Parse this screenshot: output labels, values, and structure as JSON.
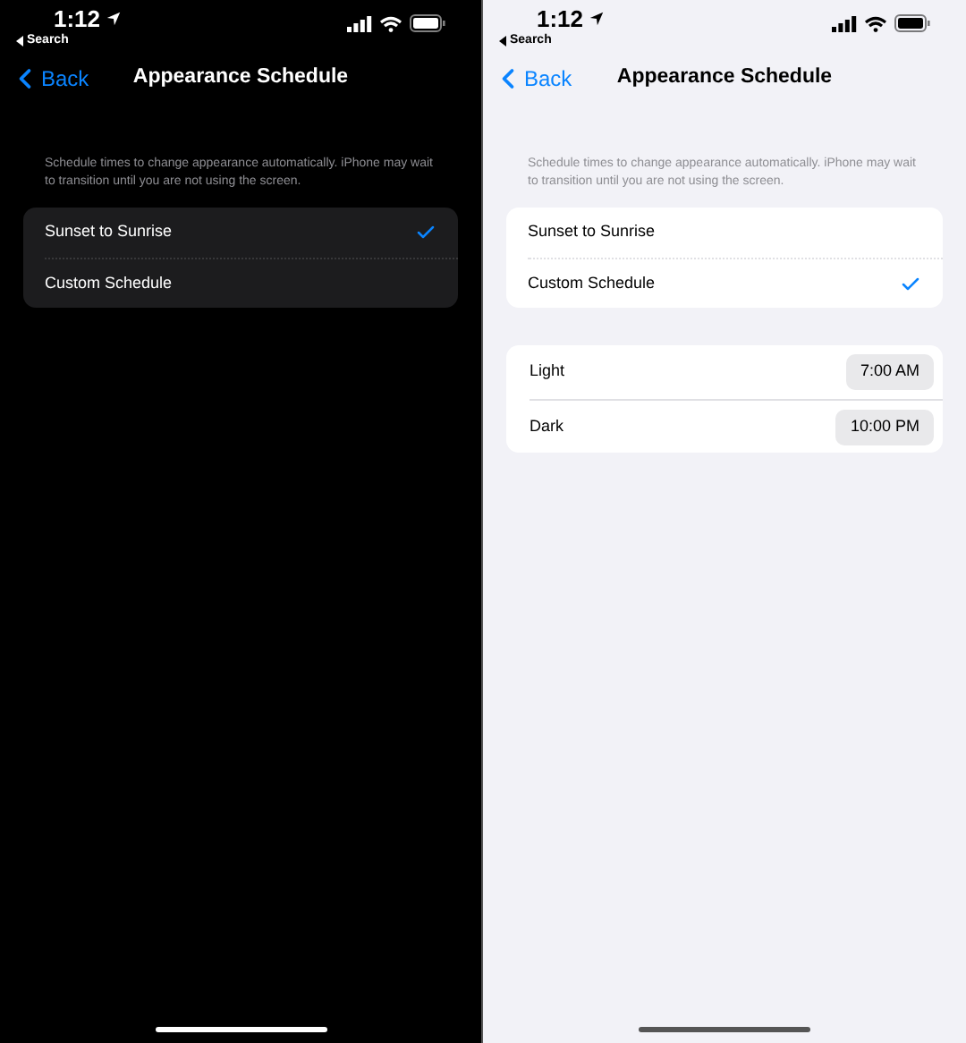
{
  "screens": [
    {
      "kind": "dark",
      "status_bar": {
        "time": "1:12",
        "back_app": "Search"
      },
      "nav": {
        "back": "Back",
        "title": "Appearance Schedule"
      },
      "description": "Schedule times to change appearance automatically. iPhone may wait to transition until you are not using the screen.",
      "options": [
        {
          "label": "Sunset to Sunrise",
          "selected": true
        },
        {
          "label": "Custom Schedule",
          "selected": false
        }
      ]
    },
    {
      "kind": "light",
      "status_bar": {
        "time": "1:12",
        "back_app": "Search"
      },
      "nav": {
        "back": "Back",
        "title": "Appearance Schedule"
      },
      "description": "Schedule times to change appearance automatically. iPhone may wait to transition until you are not using the screen.",
      "options": [
        {
          "label": "Sunset to Sunrise",
          "selected": false
        },
        {
          "label": "Custom Schedule",
          "selected": true
        }
      ],
      "times": [
        {
          "label": "Light",
          "value": "7:00 AM"
        },
        {
          "label": "Dark",
          "value": "10:00 PM"
        }
      ]
    }
  ]
}
